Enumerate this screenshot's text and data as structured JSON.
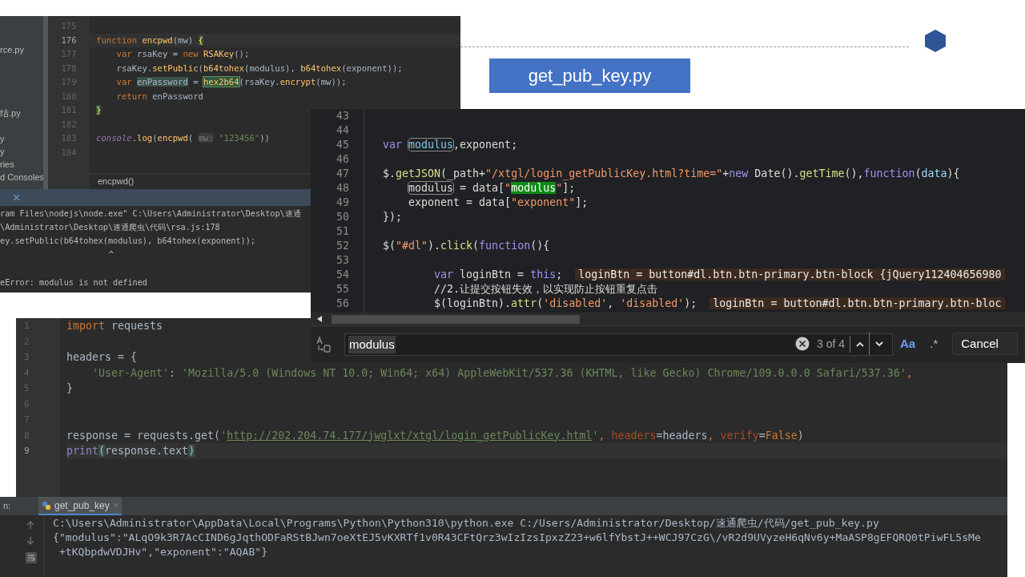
{
  "slide": {
    "title": "get_pub_key.py"
  },
  "js_editor": {
    "sidebar_items": [
      "rce.py",
      "结.py",
      "y",
      "y",
      "ries",
      "d Consoles"
    ],
    "lines": [
      {
        "num": "175",
        "current": false
      },
      {
        "num": "176",
        "current": true,
        "tokens": [
          {
            "text": "function ",
            "kind": "kw"
          },
          {
            "text": "encpwd",
            "kind": "fn"
          },
          {
            "text": "(mw) ",
            "kind": "plain"
          },
          {
            "text": "{",
            "kind": "brace"
          }
        ]
      },
      {
        "num": "177",
        "current": false,
        "tokens": [
          {
            "text": "    var",
            "kind": "kw"
          },
          {
            "text": " rsaKey = ",
            "kind": "plain"
          },
          {
            "text": "new ",
            "kind": "kw"
          },
          {
            "text": "RSAKey",
            "kind": "fn"
          },
          {
            "text": "();",
            "kind": "plain"
          }
        ]
      },
      {
        "num": "178",
        "current": false,
        "tokens": [
          {
            "text": "    rsaKey.",
            "kind": "plain"
          },
          {
            "text": "setPublic",
            "kind": "fn"
          },
          {
            "text": "(",
            "kind": "plain"
          },
          {
            "text": "b64tohex",
            "kind": "fn"
          },
          {
            "text": "(modulus), ",
            "kind": "plain"
          },
          {
            "text": "b64tohex",
            "kind": "fn"
          },
          {
            "text": "(exponent));",
            "kind": "plain"
          }
        ]
      },
      {
        "num": "179",
        "current": false,
        "tokens": [
          {
            "text": "    var ",
            "kind": "kw"
          },
          {
            "text": "enPassword",
            "kind": "usage"
          },
          {
            "text": " = ",
            "kind": "plain"
          },
          {
            "text": "hex2b64",
            "kind": "match"
          },
          {
            "text": "(rsaKey.",
            "kind": "plain"
          },
          {
            "text": "encrypt",
            "kind": "fn"
          },
          {
            "text": "(mw));",
            "kind": "plain"
          }
        ]
      },
      {
        "num": "180",
        "current": false,
        "tokens": [
          {
            "text": "    return",
            "kind": "kw"
          },
          {
            "text": " enPassword",
            "kind": "plain"
          }
        ]
      },
      {
        "num": "181",
        "current": false,
        "tokens": [
          {
            "text": "}",
            "kind": "brace"
          }
        ]
      },
      {
        "num": "182",
        "current": false
      },
      {
        "num": "183",
        "current": false,
        "tokens": [
          {
            "text": "console",
            "kind": "global"
          },
          {
            "text": ".",
            "kind": "plain"
          },
          {
            "text": "log",
            "kind": "fn"
          },
          {
            "text": "(",
            "kind": "plain"
          },
          {
            "text": "encpwd",
            "kind": "fn"
          },
          {
            "text": "( ",
            "kind": "plain"
          },
          {
            "text": "mw:",
            "kind": "hint"
          },
          {
            "text": " \"123456\"",
            "kind": "str"
          },
          {
            "text": "))",
            "kind": "plain"
          }
        ]
      },
      {
        "num": "184",
        "current": false
      }
    ],
    "breadcrumb": "encpwd()",
    "output": [
      "ram Files\\nodejs\\node.exe\" C:\\Users\\Administrator\\Desktop\\速通",
      "\\Administrator\\Desktop\\速通爬虫\\代码\\rsa.js:178",
      "ey.setPublic(b64tohex(modulus), b64tohex(exponent));",
      "^",
      "eError: modulus is not defined"
    ]
  },
  "devtools": {
    "lines": [
      {
        "num": "43"
      },
      {
        "num": "44"
      },
      {
        "num": "45",
        "kind": "top",
        "tokens": [
          {
            "text": "var ",
            "kind": "kw"
          },
          {
            "text": "modulus",
            "kind": "box"
          },
          {
            "text": ",exponent;",
            "kind": "plain"
          }
        ]
      },
      {
        "num": "46"
      },
      {
        "num": "47",
        "kind": "top",
        "tokens": [
          {
            "text": "$.",
            "kind": "plain"
          },
          {
            "text": "getJSON",
            "kind": "fn"
          },
          {
            "text": "(_path+",
            "kind": "plain"
          },
          {
            "text": "\"/xtgl/login_getPublicKey.html?time=\"",
            "kind": "str"
          },
          {
            "text": "+",
            "kind": "plain"
          },
          {
            "text": "new",
            "kind": "kw"
          },
          {
            "text": " Date().",
            "kind": "plain"
          },
          {
            "text": "getTime",
            "kind": "fn"
          },
          {
            "text": "(),",
            "kind": "plain"
          },
          {
            "text": "function",
            "kind": "kw"
          },
          {
            "text": "(",
            "kind": "plain"
          },
          {
            "text": "data",
            "kind": "param"
          },
          {
            "text": "){",
            "kind": "plain"
          }
        ]
      },
      {
        "num": "48",
        "kind": "nested",
        "tokens": [
          {
            "text": "modulus",
            "kind": "boxplain"
          },
          {
            "text": " = data[",
            "kind": "plain"
          },
          {
            "text": "\"",
            "kind": "str"
          },
          {
            "text": "modulus",
            "kind": "match"
          },
          {
            "text": "\"",
            "kind": "str"
          },
          {
            "text": "];",
            "kind": "plain"
          }
        ]
      },
      {
        "num": "49",
        "kind": "nested",
        "tokens": [
          {
            "text": "exponent = data[",
            "kind": "plain"
          },
          {
            "text": "\"exponent\"",
            "kind": "str"
          },
          {
            "text": "];",
            "kind": "plain"
          }
        ]
      },
      {
        "num": "50",
        "kind": "top",
        "tokens": [
          {
            "text": "});",
            "kind": "plain"
          }
        ]
      },
      {
        "num": "51"
      },
      {
        "num": "52",
        "kind": "top",
        "tokens": [
          {
            "text": "$(",
            "kind": "plain"
          },
          {
            "text": "\"#dl\"",
            "kind": "str"
          },
          {
            "text": ").",
            "kind": "plain"
          },
          {
            "text": "click",
            "kind": "fn"
          },
          {
            "text": "(",
            "kind": "plain"
          },
          {
            "text": "function",
            "kind": "kw"
          },
          {
            "text": "(){",
            "kind": "plain"
          }
        ]
      },
      {
        "num": "53"
      },
      {
        "num": "54",
        "kind": "deep",
        "tokens": [
          {
            "text": "var",
            "kind": "kw"
          },
          {
            "text": " loginBtn = ",
            "kind": "plain"
          },
          {
            "text": "this",
            "kind": "kw"
          },
          {
            "text": ";  ",
            "kind": "plain"
          },
          {
            "text": "loginBtn = button#dl.btn.btn-primary.btn-block {jQuery112404656980",
            "kind": "inline"
          }
        ]
      },
      {
        "num": "55",
        "kind": "deep",
        "tokens": [
          {
            "text": "//2.让提交按钮失效，以实现防止按钮重复点击",
            "kind": "plain"
          }
        ]
      },
      {
        "num": "56",
        "kind": "deep",
        "tokens": [
          {
            "text": "$(loginBtn).",
            "kind": "plain"
          },
          {
            "text": "attr",
            "kind": "fn"
          },
          {
            "text": "(",
            "kind": "plain"
          },
          {
            "text": "'disabled'",
            "kind": "str"
          },
          {
            "text": ", ",
            "kind": "plain"
          },
          {
            "text": "'disabled'",
            "kind": "str"
          },
          {
            "text": ");  ",
            "kind": "plain"
          },
          {
            "text": "loginBtn = button#dl.btn.btn-primary.btn-bloc",
            "kind": "inline"
          }
        ]
      }
    ],
    "search": {
      "value": "modulus",
      "count": "3 of 4",
      "case_button": "Aa",
      "regex_button": ".*",
      "cancel": "Cancel"
    }
  },
  "py_editor": {
    "lines": [
      {
        "num": "1",
        "current": false,
        "tokens": [
          {
            "text": "import",
            "kind": "kw"
          },
          {
            "text": " requests",
            "kind": "plain"
          }
        ]
      },
      {
        "num": "2",
        "current": false
      },
      {
        "num": "3",
        "current": false,
        "tokens": [
          {
            "text": "headers = {",
            "kind": "plain"
          }
        ]
      },
      {
        "num": "4",
        "current": false,
        "tokens": [
          {
            "text": "    'User-Agent'",
            "kind": "str"
          },
          {
            "text": ": ",
            "kind": "plain"
          },
          {
            "text": "'Mozilla/5.0 (Windows NT 10.0; Win64; x64) AppleWebKit/537.36 (KHTML, like Gecko) Chrome/109.0.0.0 Safari/537.36'",
            "kind": "str"
          },
          {
            "text": ",",
            "kind": "kw"
          }
        ]
      },
      {
        "num": "5",
        "current": false,
        "tokens": [
          {
            "text": "}",
            "kind": "plain"
          }
        ]
      },
      {
        "num": "6",
        "current": false
      },
      {
        "num": "7",
        "current": false
      },
      {
        "num": "8",
        "current": false,
        "tokens": [
          {
            "text": "response = requests.get(",
            "kind": "plain"
          },
          {
            "text": "'",
            "kind": "str"
          },
          {
            "text": "http://202.204.74.177/jwglxt/xtgl/login_getPublicKey.html",
            "kind": "url"
          },
          {
            "text": "'",
            "kind": "str"
          },
          {
            "text": ", ",
            "kind": "kw"
          },
          {
            "text": "headers",
            "kind": "param"
          },
          {
            "text": "=headers",
            "kind": "plain"
          },
          {
            "text": ", ",
            "kind": "kw"
          },
          {
            "text": "verify",
            "kind": "param"
          },
          {
            "text": "=",
            "kind": "plain"
          },
          {
            "text": "False",
            "kind": "kw"
          },
          {
            "text": ")",
            "kind": "plain"
          }
        ]
      },
      {
        "num": "9",
        "current": true,
        "tokens": [
          {
            "text": "print",
            "kind": "builtin"
          },
          {
            "text": "(",
            "kind": "brace"
          },
          {
            "text": "response.text",
            "kind": "plain"
          },
          {
            "text": ")",
            "kind": "brace"
          }
        ]
      }
    ]
  },
  "run_panel": {
    "label": "n:",
    "tab": "get_pub_key",
    "output": [
      "C:\\Users\\Administrator\\AppData\\Local\\Programs\\Python\\Python310\\python.exe C:/Users/Administrator/Desktop/速通爬虫/代码/get_pub_key.py",
      "{\"modulus\":\"ALqO9k3R7AcCIND6gJqthODFaRStBJwn7oeXtEJ5vKXRTf1v0R43CFtQrz3wIzIzsIpxzZ23+w6lfYbstJ++WCJ97CzG\\/vR2d9UVyzeH6qNv6y+MaASP8gEFQRQ0tPiwFL5sMe",
      " +tKQbpdwVDJHv\",\"exponent\":\"AQAB\"}"
    ]
  }
}
